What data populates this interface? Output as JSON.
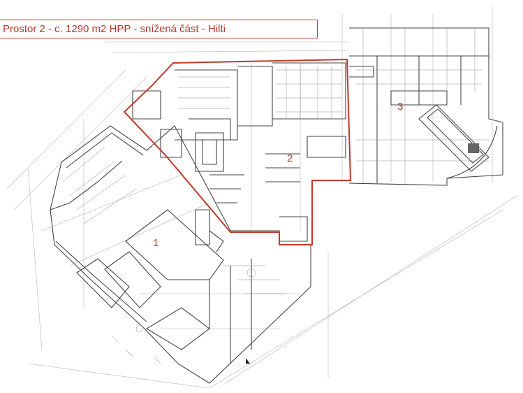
{
  "title": "Prostor 2 - c. 1290 m2 HPP - snížená část - Hilti",
  "zones": [
    {
      "id": "zone-1",
      "label": "1"
    },
    {
      "id": "zone-2",
      "label": "2"
    },
    {
      "id": "zone-3",
      "label": "3"
    }
  ],
  "colors": {
    "highlight": "#c0392b",
    "label": "#b03a2e",
    "line": "#444444",
    "faint": "#9a9a9a"
  }
}
